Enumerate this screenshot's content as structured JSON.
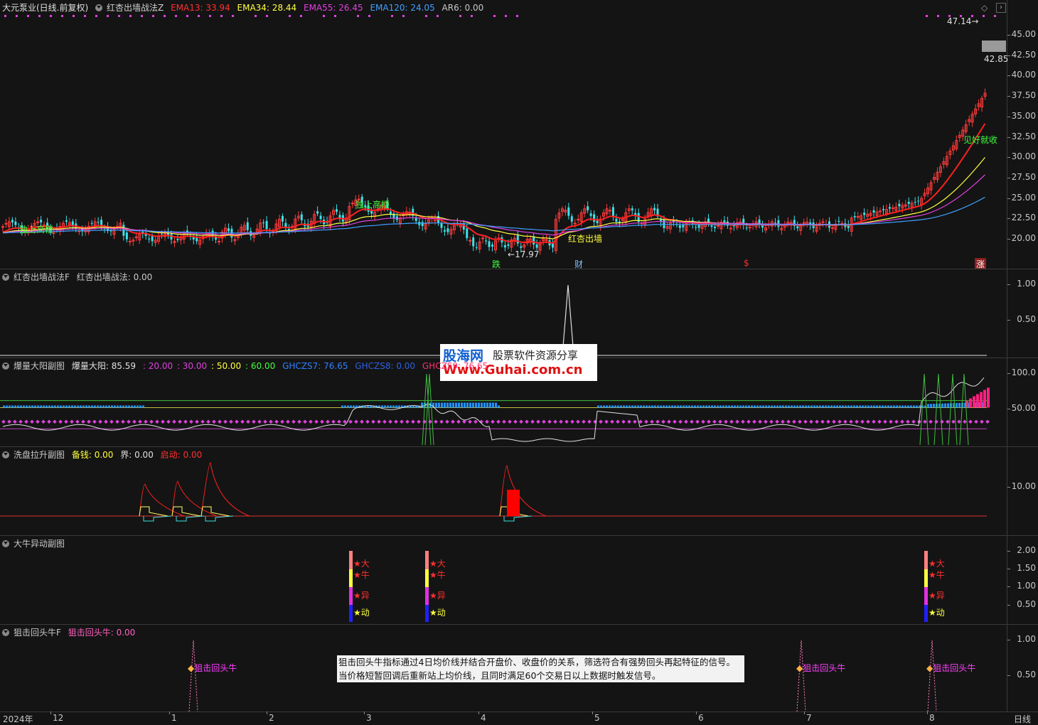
{
  "main": {
    "title": "大元泵业(日线.前复权)",
    "indicator": "红杏出墙战法Z",
    "ema13": "EMA13: 33.94",
    "ema34": "EMA34: 28.44",
    "ema55": "EMA55: 26.45",
    "ema120": "EMA120: 24.05",
    "ar6": "AR6: 0.00",
    "ticks": [
      "45.00",
      "42.50",
      "40.00",
      "37.50",
      "35.00",
      "32.50",
      "30.00",
      "27.50",
      "25.00",
      "22.50",
      "20.00"
    ],
    "high_label": "47.14",
    "price_box": "42.85",
    "low_label": "17.97",
    "annot_left": "独上高楼",
    "annot_mid": "独上高楼",
    "annot_red": "红杏出墙",
    "annot_right": "见好就收",
    "marker_die": "跌",
    "marker_cai": "财",
    "marker_s": "$",
    "marker_zhang": "涨"
  },
  "pane2": {
    "title": "红杏出墙战法F",
    "value": "红杏出墙战法: 0.00",
    "ticks": [
      "1.00",
      "0.50"
    ]
  },
  "pane3": {
    "title": "爆量大阳副图",
    "v1": "爆量大阳: 85.59",
    "v2": ": 20.00",
    "v3": ": 30.00",
    "v4": ": 50.00",
    "v5": ": 60.00",
    "v6": "GHCZS7: 76.65",
    "v7": "GHCZS8: 0.00",
    "v8": "GHCZS9: 76.65",
    "ticks": [
      "100.0",
      "50.00"
    ]
  },
  "pane4": {
    "title": "洗盘拉升副图",
    "v1": "备钱: 0.00",
    "v2": "界: 0.00",
    "v3": "启动: 0.00",
    "ticks": [
      "10.00"
    ]
  },
  "pane5": {
    "title": "大牛异动副图",
    "ticks": [
      "2.00",
      "1.50",
      "1.00",
      "0.50"
    ],
    "stars": [
      "★大",
      "★牛",
      "★异",
      "★动"
    ]
  },
  "pane6": {
    "title": "狙击回头牛F",
    "value": "狙击回头牛: 0.00",
    "ticks": [
      "1.00",
      "0.50"
    ],
    "signal": "狙击回头牛",
    "tooltip": "狙击回头牛指标通过4日均价线并结合开盘价、收盘价的关系，筛选符合有强势回头再起特征的信号。当价格短暂回调后重新站上均价线，且同时满足60个交易日以上数据时触发信号。"
  },
  "xaxis": {
    "labels": [
      "2024年",
      "12",
      "1",
      "2",
      "3",
      "4",
      "5",
      "6",
      "7",
      "8"
    ],
    "period": "日线"
  },
  "watermark": {
    "brand": "股海网",
    "slogan": "股票软件资源分享",
    "url": "Www.Guhai.com.cn"
  },
  "colors": {
    "up": "#ff3b3b",
    "down": "#3fe0e8",
    "ema13": "#ff2020",
    "ema34": "#ffff40",
    "ema55": "#e040e0",
    "ema120": "#40a0ff"
  }
}
